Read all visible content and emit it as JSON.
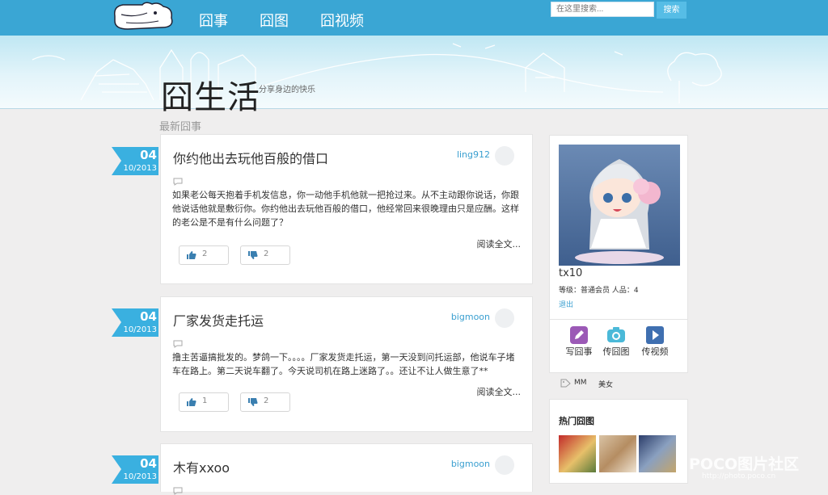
{
  "header": {
    "nav": [
      "囧事",
      "囧图",
      "囧视频"
    ],
    "search": {
      "placeholder": "在这里搜索...",
      "button": "搜索"
    }
  },
  "banner": {
    "title": "囧生活",
    "tagline": "分享身边的快乐"
  },
  "main": {
    "section_title": "最新囧事",
    "posts": [
      {
        "day": "04",
        "month": "10/2013",
        "title": "你约他出去玩他百般的借口",
        "author": "ling912",
        "excerpt": "如果老公每天抱着手机发信息，你一动他手机他就一把抢过来。从不主动跟你说话，你跟他说话他就是敷衍你。你约他出去玩他百般的借口，他经常回来很晚理由只是应酬。这样的老公是不是有什么问题了？",
        "likes": "2",
        "dislikes": "2",
        "read_more": "阅读全文..."
      },
      {
        "day": "04",
        "month": "10/2013",
        "title": "厂家发货走托运",
        "author": "bigmoon",
        "excerpt": "撸主苦逼搞批发的。梦鸽一下。。。。厂家发货走托运，第一天没到问托运部，他说车子堵车在路上。第二天说车翻了。今天说司机在路上迷路了。。还让不让人做生意了**",
        "likes": "1",
        "dislikes": "2",
        "read_more": "阅读全文..."
      },
      {
        "day": "04",
        "month": "10/2013",
        "title": "木有xxoo",
        "author": "bigmoon"
      }
    ]
  },
  "sidebar": {
    "profile": {
      "username": "tx10",
      "meta": "等级：普通会员     人品：4",
      "logout": "退出"
    },
    "actions": [
      "写囧事",
      "传囧图",
      "传视频"
    ],
    "tags": [
      "MM",
      "美女"
    ],
    "hot_title": "热门囧图"
  },
  "watermark": {
    "text": "POCO图片社区",
    "url": "http://photo.poco.cn"
  },
  "colors": {
    "header": "#3aa6d4",
    "ribbon": "#3ab0e0",
    "link": "#3a9fd0",
    "write": "#9b59b6",
    "photo": "#4bb9d8",
    "video": "#3f6fb0"
  }
}
